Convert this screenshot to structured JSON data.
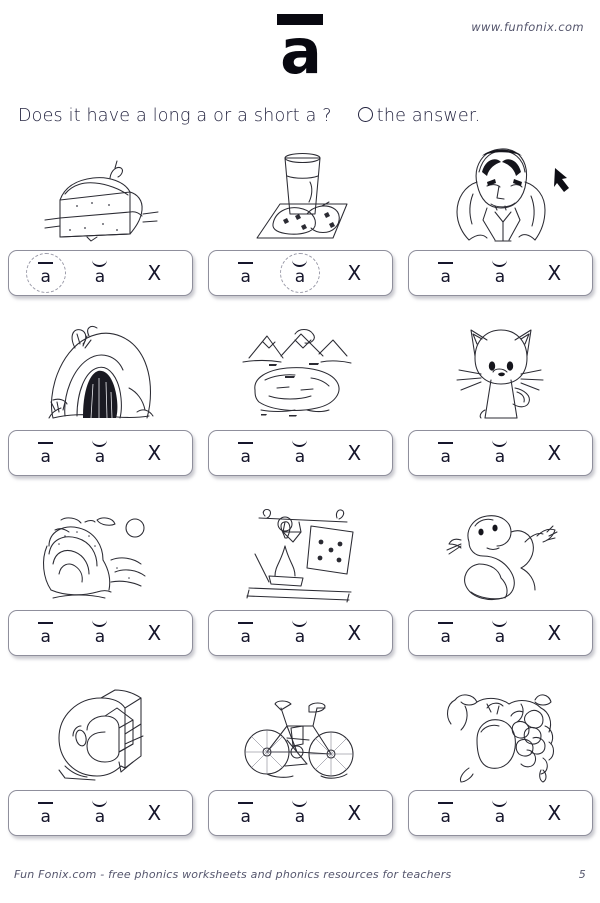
{
  "header": {
    "site_url": "www.funfonix.com",
    "title_letter": "a",
    "title_diacritic": "macron"
  },
  "instruction": {
    "question": "Does it have a long a or a short a ?",
    "action": "the answer.",
    "circle_icon": "circle-icon"
  },
  "answer_choices": {
    "long_a_label": "a",
    "short_a_label": "a",
    "none_label": "X"
  },
  "problems": [
    {
      "id": 1,
      "picture": "cake",
      "picture_label": "cake",
      "selected": "long"
    },
    {
      "id": 2,
      "picture": "snack",
      "picture_label": "snack",
      "selected": "short"
    },
    {
      "id": 3,
      "picture": "cape",
      "picture_label": "cape",
      "selected": "none-marked"
    },
    {
      "id": 4,
      "picture": "cave",
      "picture_label": "cave",
      "selected": "none-marked"
    },
    {
      "id": 5,
      "picture": "lake",
      "picture_label": "lake",
      "selected": "none-marked"
    },
    {
      "id": 6,
      "picture": "cat",
      "picture_label": "cat",
      "selected": "none-marked"
    },
    {
      "id": 7,
      "picture": "wave",
      "picture_label": "wave",
      "selected": "none-marked"
    },
    {
      "id": 8,
      "picture": "game",
      "picture_label": "game",
      "selected": "none-marked"
    },
    {
      "id": 9,
      "picture": "snake",
      "picture_label": "snake",
      "selected": "none-marked"
    },
    {
      "id": 10,
      "picture": "letter-a-block",
      "picture_label": "a",
      "selected": "none-marked"
    },
    {
      "id": 11,
      "picture": "bike",
      "picture_label": "bike",
      "selected": "none-marked"
    },
    {
      "id": 12,
      "picture": "grapes",
      "picture_label": "grapes",
      "selected": "none-marked"
    }
  ],
  "footer": {
    "credit": "Fun Fonix.com  -   free phonics worksheets and phonics resources for teachers",
    "page_number": "5"
  }
}
